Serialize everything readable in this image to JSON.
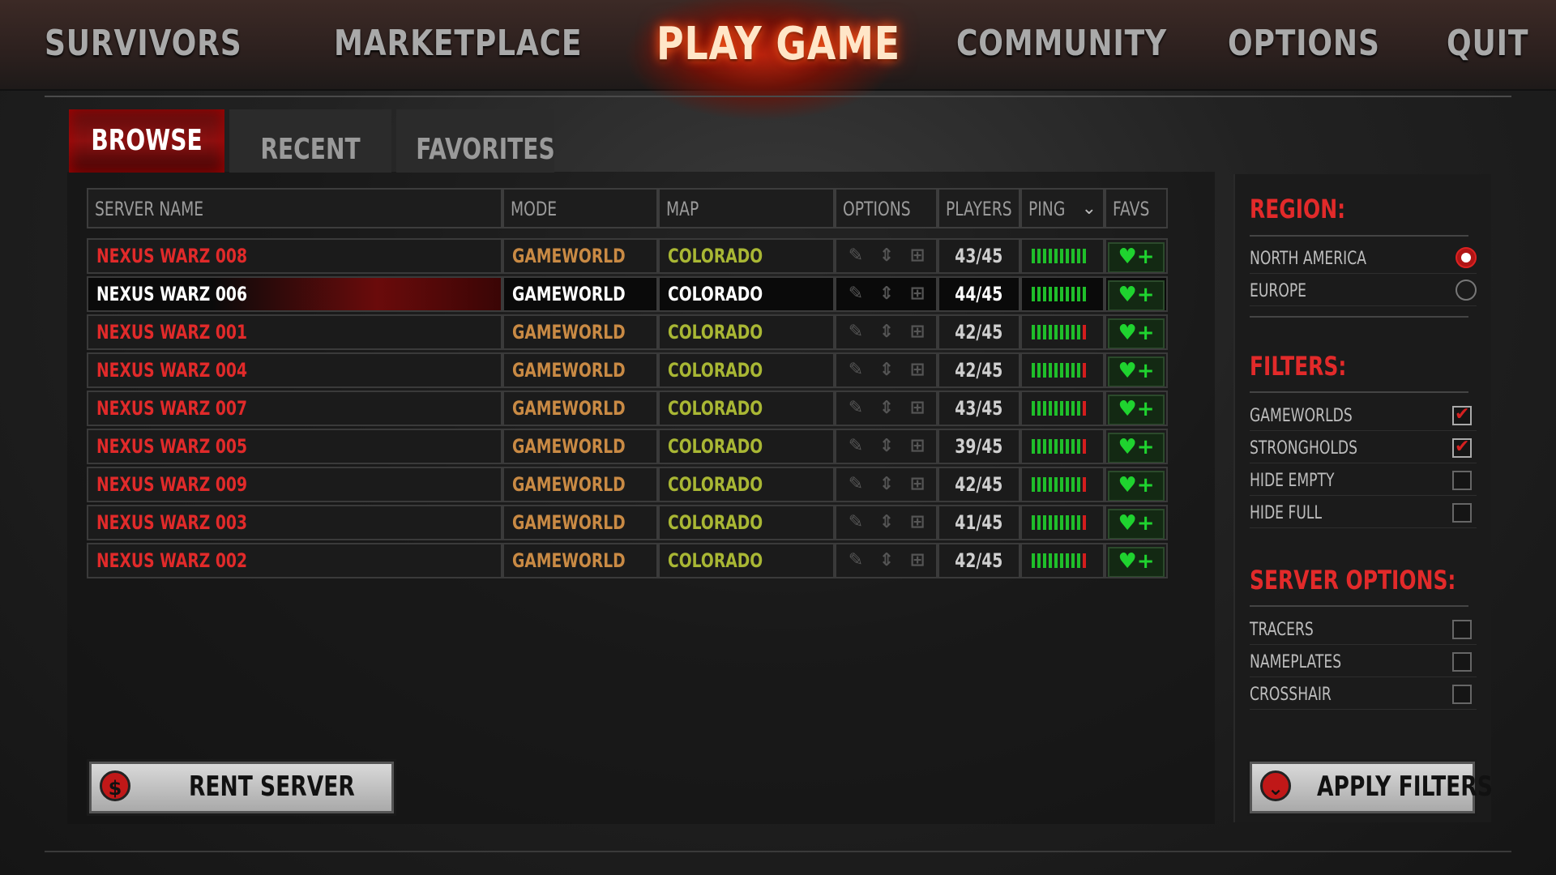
{
  "nav": {
    "items": [
      {
        "label": "SURVIVORS"
      },
      {
        "label": "MARKETPLACE"
      },
      {
        "label": "PLAY GAME"
      },
      {
        "label": "COMMUNITY"
      },
      {
        "label": "OPTIONS"
      },
      {
        "label": "QUIT"
      }
    ],
    "active": "PLAY GAME"
  },
  "tabs": [
    {
      "label": "BROWSE",
      "active": true
    },
    {
      "label": "RECENT",
      "active": false
    },
    {
      "label": "FAVORITES",
      "active": false
    }
  ],
  "table": {
    "columns": [
      "SERVER NAME",
      "MODE",
      "MAP",
      "OPTIONS",
      "PLAYERS",
      "PING",
      "FAVS"
    ],
    "rows": [
      {
        "name": "NEXUS WARZ 008",
        "mode": "GAMEWORLD",
        "map": "COLORADO",
        "players": "43/45",
        "ping_red_bars": 0,
        "selected": false
      },
      {
        "name": "NEXUS WARZ 006",
        "mode": "GAMEWORLD",
        "map": "COLORADO",
        "players": "44/45",
        "ping_red_bars": 0,
        "selected": true
      },
      {
        "name": "NEXUS WARZ 001",
        "mode": "GAMEWORLD",
        "map": "COLORADO",
        "players": "42/45",
        "ping_red_bars": 1,
        "selected": false
      },
      {
        "name": "NEXUS WARZ 004",
        "mode": "GAMEWORLD",
        "map": "COLORADO",
        "players": "42/45",
        "ping_red_bars": 1,
        "selected": false
      },
      {
        "name": "NEXUS WARZ 007",
        "mode": "GAMEWORLD",
        "map": "COLORADO",
        "players": "43/45",
        "ping_red_bars": 1,
        "selected": false
      },
      {
        "name": "NEXUS WARZ 005",
        "mode": "GAMEWORLD",
        "map": "COLORADO",
        "players": "39/45",
        "ping_red_bars": 1,
        "selected": false
      },
      {
        "name": "NEXUS WARZ 009",
        "mode": "GAMEWORLD",
        "map": "COLORADO",
        "players": "42/45",
        "ping_red_bars": 1,
        "selected": false
      },
      {
        "name": "NEXUS WARZ 003",
        "mode": "GAMEWORLD",
        "map": "COLORADO",
        "players": "41/45",
        "ping_red_bars": 1,
        "selected": false
      },
      {
        "name": "NEXUS WARZ 002",
        "mode": "GAMEWORLD",
        "map": "COLORADO",
        "players": "42/45",
        "ping_red_bars": 1,
        "selected": false
      }
    ]
  },
  "sidebar": {
    "region_title": "REGION:",
    "regions": [
      {
        "label": "NORTH AMERICA",
        "selected": true
      },
      {
        "label": "EUROPE",
        "selected": false
      }
    ],
    "filters_title": "FILTERS:",
    "filters": [
      {
        "label": "GAMEWORLDS",
        "checked": true
      },
      {
        "label": "STRONGHOLDS",
        "checked": true
      },
      {
        "label": "HIDE EMPTY",
        "checked": false
      },
      {
        "label": "HIDE FULL",
        "checked": false
      }
    ],
    "server_options_title": "SERVER OPTIONS:",
    "server_options": [
      {
        "label": "TRACERS",
        "checked": false
      },
      {
        "label": "NAMEPLATES",
        "checked": false
      },
      {
        "label": "CROSSHAIR",
        "checked": false
      }
    ]
  },
  "buttons": {
    "rent_server": "RENT SERVER",
    "rent_icon": "$",
    "apply_filters": "APPLY FILTERS"
  },
  "colors": {
    "accent_red": "#e12a2a",
    "mode_orange": "#c98a44",
    "map_yellowgreen": "#a9b734",
    "ping_green": "#1fbf2a"
  },
  "icons": [
    "pencil-icon",
    "move-icon",
    "crosshair-plus-icon",
    "heart-plus-icon",
    "chevron-down-icon",
    "dollar-icon"
  ]
}
